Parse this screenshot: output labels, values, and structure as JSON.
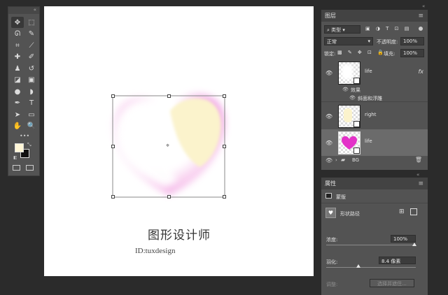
{
  "toolbar": {
    "grip": "«",
    "tools": [
      {
        "name": "move-tool",
        "glyph": "✥"
      },
      {
        "name": "marquee-tool",
        "glyph": "⬚"
      },
      {
        "name": "lasso-tool",
        "glyph": "ᘏ"
      },
      {
        "name": "quick-select-tool",
        "glyph": "✎"
      },
      {
        "name": "crop-tool",
        "glyph": "⌗"
      },
      {
        "name": "eyedropper-tool",
        "glyph": "⟋"
      },
      {
        "name": "healing-tool",
        "glyph": "✚"
      },
      {
        "name": "brush-tool",
        "glyph": "✐"
      },
      {
        "name": "stamp-tool",
        "glyph": "♟"
      },
      {
        "name": "history-brush-tool",
        "glyph": "↺"
      },
      {
        "name": "eraser-tool",
        "glyph": "◪"
      },
      {
        "name": "gradient-tool",
        "glyph": "▣"
      },
      {
        "name": "blur-tool",
        "glyph": "●"
      },
      {
        "name": "dodge-tool",
        "glyph": "◗"
      },
      {
        "name": "pen-tool",
        "glyph": "✒"
      },
      {
        "name": "type-tool",
        "glyph": "T"
      },
      {
        "name": "path-select-tool",
        "glyph": "➤"
      },
      {
        "name": "shape-tool",
        "glyph": "▭"
      },
      {
        "name": "hand-tool",
        "glyph": "✋"
      },
      {
        "name": "zoom-tool",
        "glyph": "🔍"
      }
    ],
    "more": "•••"
  },
  "canvas": {
    "title": "图形设计师",
    "id_text": "ID:tuxdesign"
  },
  "layers_panel": {
    "tab": "图层",
    "menu": "≡",
    "filter_label": "类型",
    "blend_mode": "正常",
    "opacity_label": "不透明度:",
    "opacity_value": "100%",
    "lock_label": "锁定:",
    "fill_label": "填充:",
    "fill_value": "100%",
    "layers": [
      {
        "name": "life",
        "fx": "fx",
        "effects_label": "效果",
        "effect_item": "斜面和浮雕"
      },
      {
        "name": "right"
      },
      {
        "name": "life"
      },
      {
        "name": "BG"
      }
    ]
  },
  "properties_panel": {
    "tab": "属性",
    "menu": "≡",
    "mask_label": "蒙版",
    "shape_label": "形状路径",
    "density_label": "浓度:",
    "density_value": "100%",
    "feather_label": "羽化:",
    "feather_value": "8.4 像素",
    "adjust_label": "调整:",
    "select_refine_button": "选择并遮住..."
  },
  "colors": {
    "foreground": "#fff6d6",
    "background": "#111111",
    "heart_pink": "#f2a6e0",
    "heart_yellow": "#fbf4cf",
    "thumb_magenta": "#e332c8"
  }
}
